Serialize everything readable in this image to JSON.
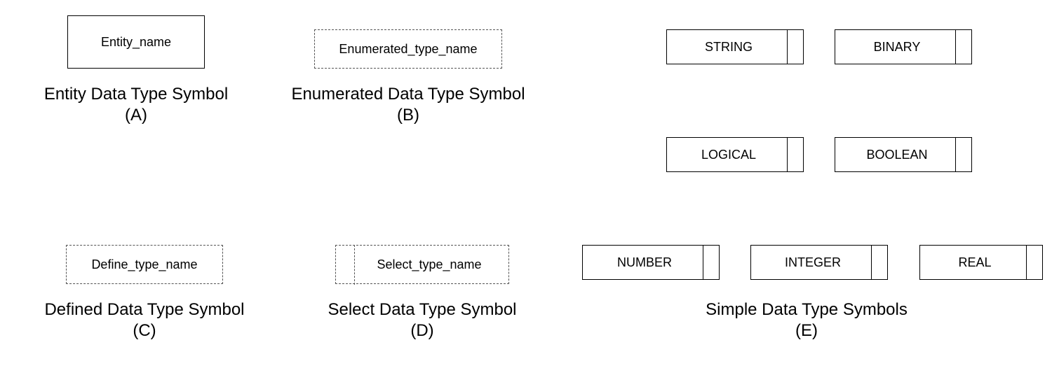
{
  "symbols": {
    "entity": {
      "box_label": "Entity_name",
      "caption": "Entity Data Type Symbol\n(A)"
    },
    "enumerated": {
      "box_label": "Enumerated_type_name",
      "caption": "Enumerated Data Type Symbol\n(B)"
    },
    "defined": {
      "box_label": "Define_type_name",
      "caption": "Defined Data Type Symbol\n(C)"
    },
    "select": {
      "box_label": "Select_type_name",
      "caption": "Select Data Type Symbol\n(D)"
    },
    "simple": {
      "caption": "Simple Data Type Symbols\n(E)",
      "types": {
        "string": "STRING",
        "binary": "BINARY",
        "logical": "LOGICAL",
        "boolean": "BOOLEAN",
        "number": "NUMBER",
        "integer": "INTEGER",
        "real": "REAL"
      }
    }
  }
}
